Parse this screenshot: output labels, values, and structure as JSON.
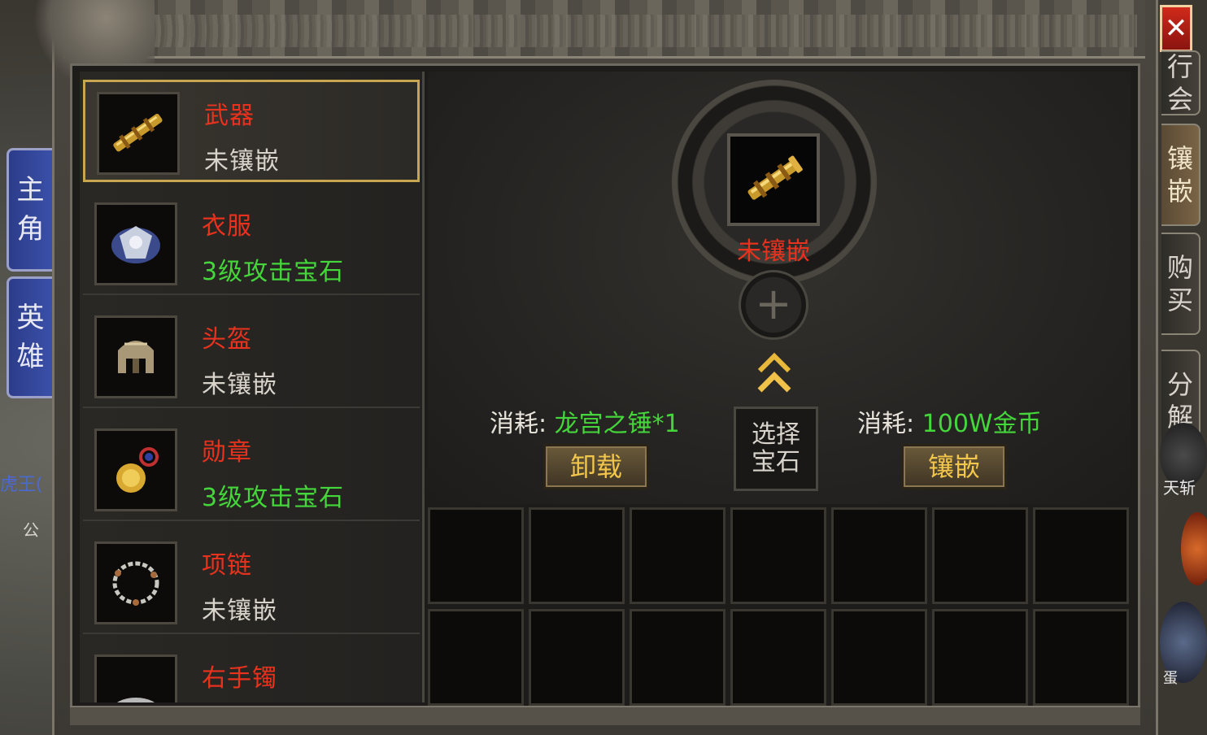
{
  "close_button": "✕",
  "left_tabs": [
    "主角",
    "英雄"
  ],
  "map_labels": {
    "npc": "虎王(",
    "other": "公"
  },
  "right_tabs": [
    {
      "label": "行会",
      "active": false
    },
    {
      "label": "镶嵌",
      "active": true
    },
    {
      "label": "购买",
      "active": false
    },
    {
      "label": "分解",
      "active": false
    }
  ],
  "right_labels": {
    "skill": "天斩",
    "egg": "蛋"
  },
  "equipment": [
    {
      "name": "武器",
      "status": "未镶嵌",
      "status_color": "#d8d4cc",
      "icon": "golden-hammer",
      "selected": true
    },
    {
      "name": "衣服",
      "status": "3级攻击宝石",
      "status_color": "#44d63a",
      "icon": "armor",
      "selected": false
    },
    {
      "name": "头盔",
      "status": "未镶嵌",
      "status_color": "#d8d4cc",
      "icon": "helmet",
      "selected": false
    },
    {
      "name": "勋章",
      "status": "3级攻击宝石",
      "status_color": "#44d63a",
      "icon": "medal",
      "selected": false
    },
    {
      "name": "项链",
      "status": "未镶嵌",
      "status_color": "#d8d4cc",
      "icon": "necklace",
      "selected": false
    },
    {
      "name": "右手镯",
      "status": "",
      "status_color": "#d8d4cc",
      "icon": "bracelet",
      "selected": false
    }
  ],
  "inlay": {
    "center_status": "未镶嵌",
    "plus": "+",
    "select_gem": [
      "选择",
      "宝石"
    ],
    "unload": {
      "cost_label": "消耗:",
      "cost_value": "龙宫之锤*1",
      "button": "卸载"
    },
    "embed": {
      "cost_label": "消耗:",
      "cost_value": "100W金币",
      "button": "镶嵌"
    }
  },
  "gem_grid": {
    "rows": 2,
    "cols": 7
  },
  "colors": {
    "name_red": "#e8321e",
    "value_green": "#44d63a",
    "gold": "#f2c64a",
    "frame": "#c8a650"
  }
}
